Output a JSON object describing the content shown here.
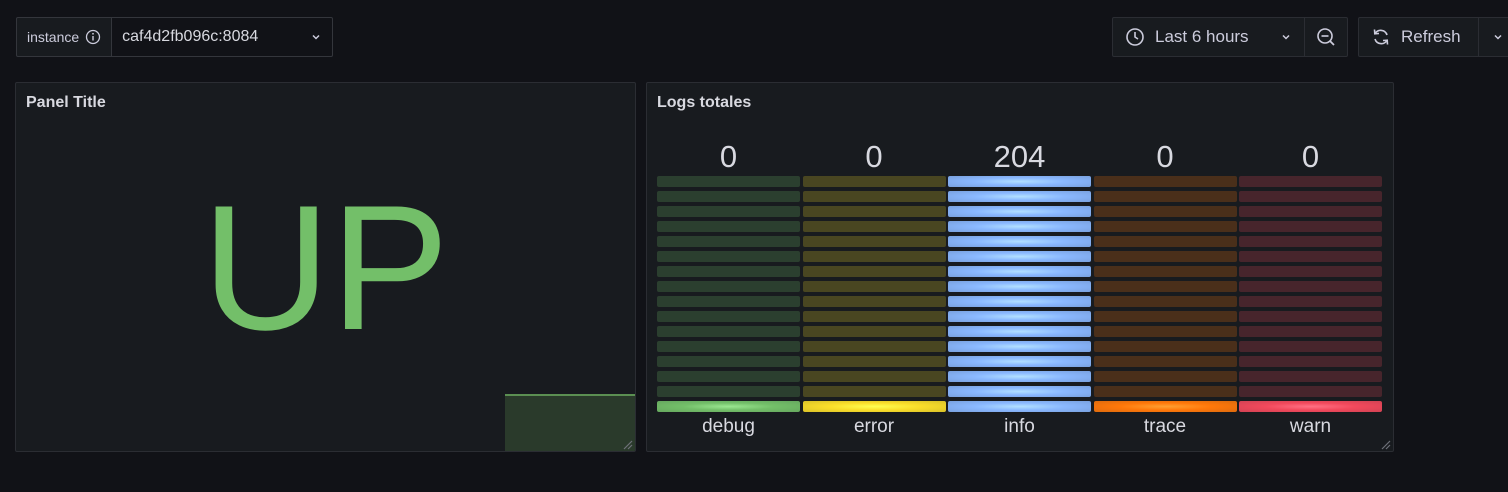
{
  "variable": {
    "label": "instance",
    "value": "caf4d2fb096c:8084"
  },
  "toolbar": {
    "time_range": "Last 6 hours",
    "refresh": "Refresh"
  },
  "panels": {
    "status": {
      "title": "Panel Title",
      "value": "UP",
      "value_color": "#73bf69"
    },
    "logs": {
      "title": "Logs totales",
      "bars": [
        {
          "label": "debug",
          "value": "0",
          "fraction": 0,
          "color": "#73bf69"
        },
        {
          "label": "error",
          "value": "0",
          "fraction": 0,
          "color": "#fade2a"
        },
        {
          "label": "info",
          "value": "204",
          "fraction": 1,
          "color": "#8ab8ff"
        },
        {
          "label": "trace",
          "value": "0",
          "fraction": 0,
          "color": "#ff780a"
        },
        {
          "label": "warn",
          "value": "0",
          "fraction": 0,
          "color": "#f2495c"
        }
      ]
    }
  },
  "icons": {
    "info": "info-circle-icon",
    "caret": "chevron-down-icon",
    "clock": "clock-icon",
    "zoom_out": "zoom-out-icon",
    "refresh": "sync-icon"
  }
}
